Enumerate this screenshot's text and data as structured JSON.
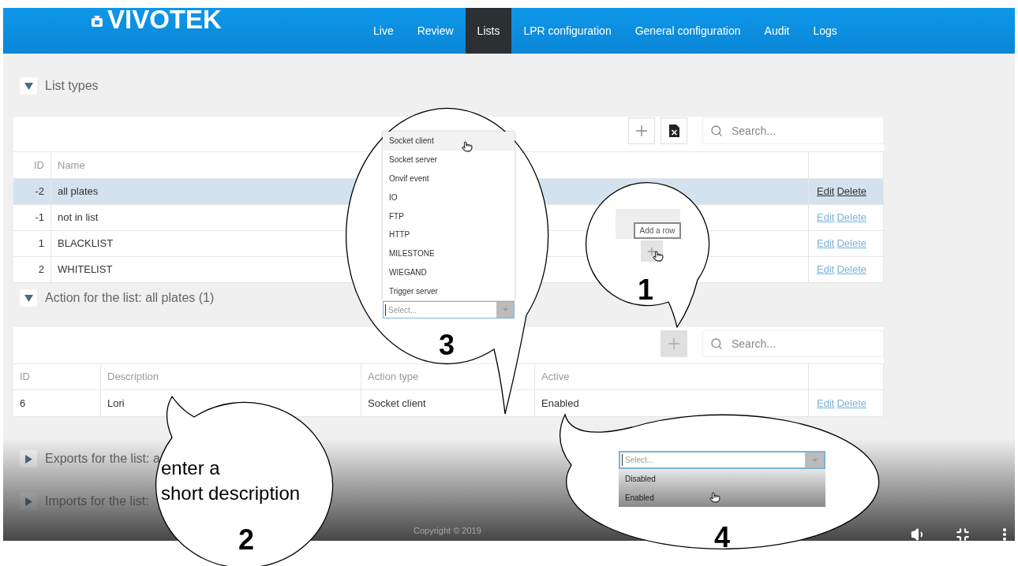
{
  "header": {
    "logo": "VIVOTEK",
    "nav": [
      {
        "label": "Live",
        "selected": false
      },
      {
        "label": "Review",
        "selected": false
      },
      {
        "label": "Lists",
        "selected": true
      },
      {
        "label": "LPR configuration",
        "selected": false
      },
      {
        "label": "General configuration",
        "selected": false
      },
      {
        "label": "Audit",
        "selected": false
      },
      {
        "label": "Logs",
        "selected": false
      }
    ]
  },
  "list_types": {
    "title": "List types",
    "expanded": true,
    "search": {
      "placeholder": "Search..."
    },
    "columns": [
      "ID",
      "Name"
    ],
    "rows": [
      {
        "id": "-2",
        "name": "all plates",
        "selected": true,
        "actions": [
          "Edit",
          "Delete"
        ]
      },
      {
        "id": "-1",
        "name": "not in list",
        "selected": false,
        "actions": [
          "Edit",
          "Delete"
        ]
      },
      {
        "id": "1",
        "name": "BLACKLIST",
        "selected": false,
        "actions": [
          "Edit",
          "Delete"
        ]
      },
      {
        "id": "2",
        "name": "WHITELIST",
        "selected": false,
        "actions": [
          "Edit",
          "Delete"
        ]
      }
    ]
  },
  "actions": {
    "title": "Action for the list: all plates (1)",
    "expanded": true,
    "add_button": {
      "disabled": true
    },
    "search": {
      "placeholder": "Search..."
    },
    "columns": [
      "ID",
      "Description",
      "Action type",
      "Active"
    ],
    "rows": [
      {
        "cells": [
          "6",
          "Lori",
          "Socket client",
          "Enabled"
        ],
        "actions": [
          "Edit",
          "Delete"
        ]
      }
    ]
  },
  "exports": {
    "title": "Exports for the list: a",
    "expanded": false
  },
  "imports": {
    "title": "Imports for the list:",
    "expanded": false
  },
  "footer": {
    "copyright": "Copyright © 2019"
  },
  "callouts": [
    {
      "kind": "tooltip",
      "number": "1",
      "tooltip": "Add a row"
    },
    {
      "kind": "note",
      "number": "2",
      "lines": [
        "enter a",
        "short description"
      ]
    },
    {
      "kind": "dropdown_up",
      "number": "3",
      "placeholder": "Select...",
      "options": [
        {
          "label": "Socket client",
          "hovered": true
        },
        {
          "label": "Socket server",
          "hovered": false
        },
        {
          "label": "Onvif event",
          "hovered": false
        },
        {
          "label": "IO",
          "hovered": false
        },
        {
          "label": "FTP",
          "hovered": false
        },
        {
          "label": "HTTP",
          "hovered": false
        },
        {
          "label": "MILESTONE",
          "hovered": false
        },
        {
          "label": "WIEGAND",
          "hovered": false
        },
        {
          "label": "Trigger server",
          "hovered": false
        }
      ]
    },
    {
      "kind": "dropdown_down",
      "number": "4",
      "placeholder": "Select...",
      "options": [
        {
          "label": "Disabled"
        },
        {
          "label": "Enabled"
        }
      ]
    }
  ]
}
